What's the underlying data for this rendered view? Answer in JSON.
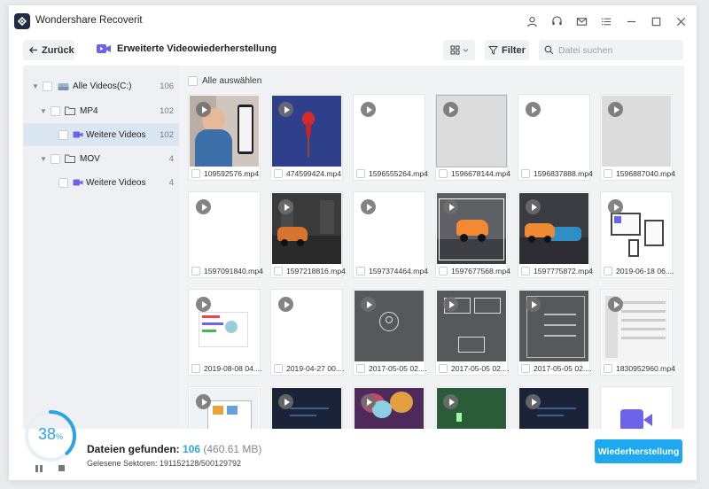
{
  "app": {
    "title": "Wondershare Recoverit"
  },
  "toolbar": {
    "back_label": "Zurück",
    "page_title": "Erweiterte Videowiederherstellung",
    "filter_label": "Filter",
    "search_placeholder": "Datei suchen"
  },
  "sidebar": {
    "items": [
      {
        "label": "Alle Videos(C:)",
        "count": "106",
        "icon": "drive-icon"
      },
      {
        "label": "MP4",
        "count": "102",
        "icon": "folder-icon"
      },
      {
        "label": "Weitere Videos",
        "count": "102",
        "icon": "video-icon",
        "selected": true
      },
      {
        "label": "MOV",
        "count": "4",
        "icon": "folder-icon"
      },
      {
        "label": "Weitere Videos",
        "count": "4",
        "icon": "video-icon"
      }
    ]
  },
  "content": {
    "select_all_label": "Alle auswählen",
    "files": [
      {
        "name": "109592576.mp4",
        "thumb": "person"
      },
      {
        "name": "474599424.mp4",
        "thumb": "flower"
      },
      {
        "name": "1596555264.mp4",
        "thumb": "blank"
      },
      {
        "name": "1596678144.mp4",
        "thumb": "gray",
        "highlighted": true
      },
      {
        "name": "1596837888.mp4",
        "thumb": "blank"
      },
      {
        "name": "1596887040.mp4",
        "thumb": "gray"
      },
      {
        "name": "1597091840.mp4",
        "thumb": "blank"
      },
      {
        "name": "1597218816.mp4",
        "thumb": "car"
      },
      {
        "name": "1597374464.mp4",
        "thumb": "blank"
      },
      {
        "name": "1597677568.mp4",
        "thumb": "car-select"
      },
      {
        "name": "1597775872.mp4",
        "thumb": "car-blue"
      },
      {
        "name": "2019-06-18 06....",
        "thumb": "devices"
      },
      {
        "name": "2019-08-08 04....",
        "thumb": "chart-doc"
      },
      {
        "name": "2019-04-27 00....",
        "thumb": "blank"
      },
      {
        "name": "2017-05-05 02....",
        "thumb": "dark-ui-1"
      },
      {
        "name": "2017-05-05 02....",
        "thumb": "dark-ui-2"
      },
      {
        "name": "2017-05-05 02....",
        "thumb": "dark-ui-3"
      },
      {
        "name": "1830952960.mp4",
        "thumb": "doc-list"
      },
      {
        "name": "",
        "thumb": "slides"
      },
      {
        "name": "",
        "thumb": "dark-blue"
      },
      {
        "name": "",
        "thumb": "crowd"
      },
      {
        "name": "",
        "thumb": "green"
      },
      {
        "name": "",
        "thumb": "dark-blue"
      },
      {
        "name": "",
        "thumb": "video-file"
      }
    ]
  },
  "footer": {
    "progress_percent": 38,
    "pct_number": "38",
    "pct_sign": "%",
    "found_label": "Dateien gefunden:",
    "found_count": "106",
    "found_size": "(460.61 MB)",
    "sectors_label": "Gelesene Sektoren: 191152128/500129792",
    "recover_label": "Wiederherstellung"
  },
  "colors": {
    "accent": "#1ea8ef",
    "progress": "#2ba4e6",
    "selected": "#dbe6f3"
  }
}
